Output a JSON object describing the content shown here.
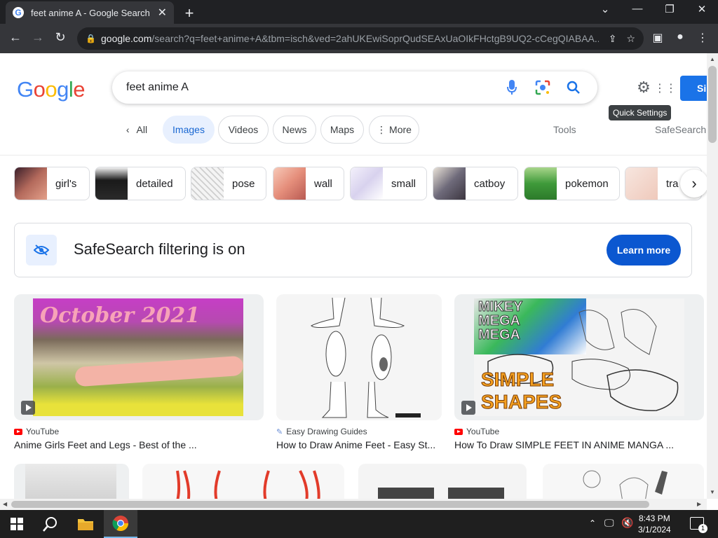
{
  "browser": {
    "tab_title": "feet anime A - Google Search",
    "url_host": "google.com",
    "url_path": "/search?q=feet+anime+A&tbm=isch&ved=2ahUKEwiSoprQudSEAxUaOIkFHctgB9UQ2-cCegQIABAA..."
  },
  "search": {
    "query": "feet anime A",
    "logo": "Google",
    "signin_label": "Si",
    "tooltip": "Quick Settings"
  },
  "filters": {
    "back_label": "All",
    "items": [
      "Images",
      "Videos",
      "News",
      "Maps",
      "More"
    ],
    "tools": "Tools",
    "safesearch": "SafeSearch"
  },
  "suggestions": [
    "girl's",
    "detailed",
    "pose",
    "wall",
    "small",
    "catboy",
    "pokemon",
    "tra"
  ],
  "safesearch_banner": {
    "text": "SafeSearch filtering is on",
    "button": "Learn more"
  },
  "results": [
    {
      "source": "YouTube",
      "title": "Anime Girls Feet and Legs - Best of the ...",
      "overlay": "October 2021"
    },
    {
      "source": "Easy Drawing Guides",
      "title": "How to Draw Anime Feet - Easy St..."
    },
    {
      "source": "YouTube",
      "title": "How To Draw SIMPLE FEET IN ANIME MANGA ...",
      "overlay_top": "MIKEY MEGA MEGA",
      "overlay_bottom": "SIMPLE SHAPES"
    }
  ],
  "taskbar": {
    "time": "8:43 PM",
    "date": "3/1/2024",
    "notifications": "1"
  }
}
